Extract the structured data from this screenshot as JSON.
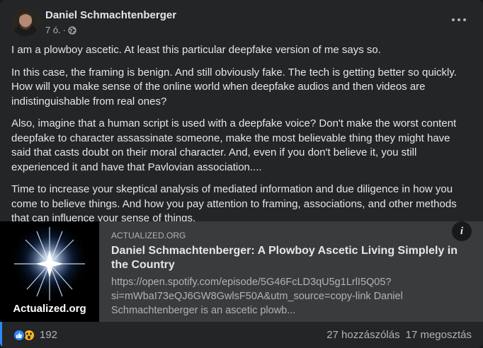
{
  "post": {
    "author": "Daniel Schmachtenberger",
    "time": "7 ó.",
    "separator": "·",
    "privacy_icon": "globe-icon",
    "menu_icon": "more-horizontal-icon"
  },
  "body": {
    "paragraphs": [
      "I am a plowboy ascetic. At least this particular deepfake version of me says so.",
      "In this case, the framing is benign. And still obviously fake. The tech is getting better so quickly. How will you make sense of the online world when deepfake audios and then videos are indistinguishable from real ones?",
      "Also, imagine that a human script is used with a deepfake voice? Don't make the worst content deepfake to character assassinate someone, make the most believable thing they might have said that casts doubt on their moral character. And, even if you don't believe it, you still experienced it and have that Pavlovian association....",
      "Time to increase your skeptical analysis of mediated information and due diligence in how you come to believe things. And how you pay attention to framing, associations, and other methods that can influence your sense of things."
    ]
  },
  "link": {
    "domain": "ACTUALIZED.ORG",
    "title": "Daniel Schmachtenberger: A Plowboy Ascetic Living Simplely in the Country",
    "description": "https://open.spotify.com/episode/5G46FcLD3qU5g1LrlI5Q05?si=mWbaI73eQJ6GW8GwlsF50A&utm_source=copy-link Daniel Schmachtenberger is an ascetic plowb...",
    "thumbnail_label": "Actualized.org",
    "info_label": "i"
  },
  "footer": {
    "reaction_count": "192",
    "comments": "27 hozzászólás",
    "shares": "17 megosztás",
    "reaction_icons": [
      "like-icon",
      "wow-icon"
    ]
  },
  "colors": {
    "card_bg": "#242526",
    "link_bg": "#3a3b3c",
    "accent": "#2d88ff",
    "text_primary": "#e4e6eb",
    "text_secondary": "#b0b3b8"
  }
}
